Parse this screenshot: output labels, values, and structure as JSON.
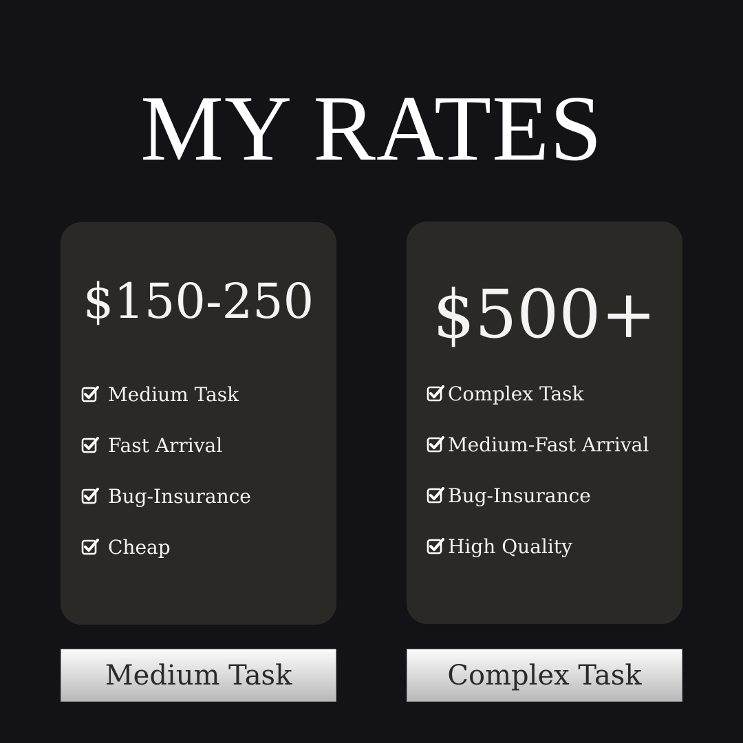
{
  "header": {
    "title": "MY RATES"
  },
  "plans": [
    {
      "price": "$150-250",
      "features": [
        "Medium Task",
        "Fast Arrival",
        "Bug-Insurance",
        "Cheap"
      ],
      "button_label": "Medium Task"
    },
    {
      "price": "$500+",
      "features": [
        "Complex Task",
        "Medium-Fast Arrival",
        "Bug-Insurance",
        "High Quality"
      ],
      "button_label": "Complex Task"
    }
  ],
  "icons": {
    "feature_check": "checkbox-check-icon"
  },
  "colors": {
    "background": "#131217",
    "card": "#2a2926",
    "text": "#ffffff",
    "button_text": "#2a2a2a"
  }
}
